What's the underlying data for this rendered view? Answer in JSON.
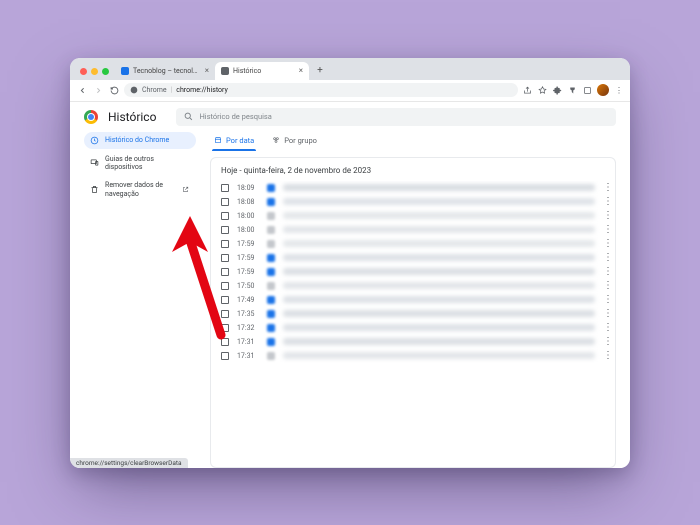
{
  "browser": {
    "tabs": [
      {
        "label": "Tecnoblog – tecnologia que i",
        "favicon": "#1a73e8"
      },
      {
        "label": "Histórico",
        "favicon": "#5f6368"
      }
    ],
    "omnibox": {
      "scheme": "Chrome",
      "path": "chrome://history"
    },
    "status_url": "chrome://settings/clearBrowserData"
  },
  "page": {
    "title": "Histórico",
    "search_placeholder": "Histórico de pesquisa"
  },
  "sidebar": {
    "items": [
      {
        "label": "Histórico do Chrome"
      },
      {
        "label": "Guias de outros dispositivos"
      },
      {
        "label": "Remover dados de navegação"
      }
    ]
  },
  "filter_tabs": {
    "by_date": "Por data",
    "by_group": "Por grupo"
  },
  "history": {
    "date_header": "Hoje - quinta-feira, 2 de novembro de 2023",
    "rows": [
      {
        "time": "18:09",
        "fav": "#1a73e8",
        "bg": "#d9dde2"
      },
      {
        "time": "18:08",
        "fav": "#1a73e8",
        "bg": "#dfe3e8"
      },
      {
        "time": "18:00",
        "fav": "#c4c7cc",
        "bg": "#e4e7ea"
      },
      {
        "time": "18:00",
        "fav": "#c4c7cc",
        "bg": "#e2e5e9"
      },
      {
        "time": "17:59",
        "fav": "#c4c7cc",
        "bg": "#e4e7ea"
      },
      {
        "time": "17:59",
        "fav": "#1a73e8",
        "bg": "#dde1e6"
      },
      {
        "time": "17:59",
        "fav": "#1a73e8",
        "bg": "#dbdfe4"
      },
      {
        "time": "17:50",
        "fav": "#c4c7cc",
        "bg": "#e2e5e9"
      },
      {
        "time": "17:49",
        "fav": "#1a73e8",
        "bg": "#dde1e6"
      },
      {
        "time": "17:35",
        "fav": "#1a73e8",
        "bg": "#dbdfe4"
      },
      {
        "time": "17:32",
        "fav": "#1a73e8",
        "bg": "#dde1e6"
      },
      {
        "time": "17:31",
        "fav": "#1a73e8",
        "bg": "#dbdfe4"
      },
      {
        "time": "17:31",
        "fav": "#c4c7cc",
        "bg": "#e2e5e9"
      }
    ]
  }
}
